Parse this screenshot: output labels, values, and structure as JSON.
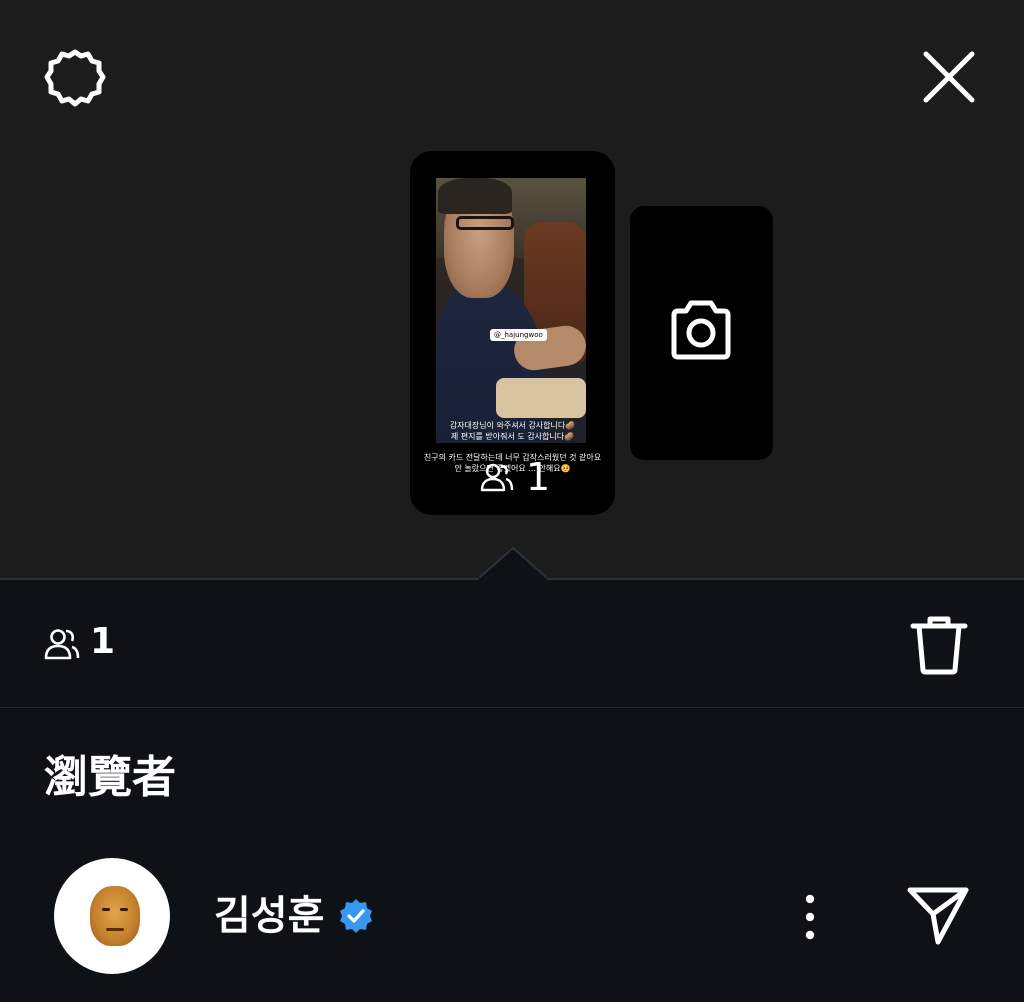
{
  "story_preview": {
    "mention_tag": "@_hajungwoo",
    "caption_line_1": "감자대장님이 와주셔서 감사합니다🥔",
    "caption_line_2": "제 편지를 받아줘서 도 감사합니다🥔",
    "caption_line_3": "친구의 카드 전달하는데 너무 갑작스러웠던 것 같아요",
    "caption_line_4": "안 놀랐으면 좋겠어요 ... 안해요🥺",
    "viewer_count": "1"
  },
  "viewers_bar": {
    "count": "1"
  },
  "section": {
    "title": "瀏覽者"
  },
  "viewer": {
    "name": "김성훈"
  },
  "colors": {
    "top_background": "#1c1c1c",
    "bottom_background": "#0e1116",
    "verified_badge": "#3897f0"
  },
  "icons": {
    "settings": "gear-icon",
    "close": "close-icon",
    "camera": "camera-icon",
    "viewers": "people-icon",
    "trash": "trash-icon",
    "verified": "verified-badge-icon",
    "more": "more-vertical-icon",
    "send": "send-icon"
  }
}
